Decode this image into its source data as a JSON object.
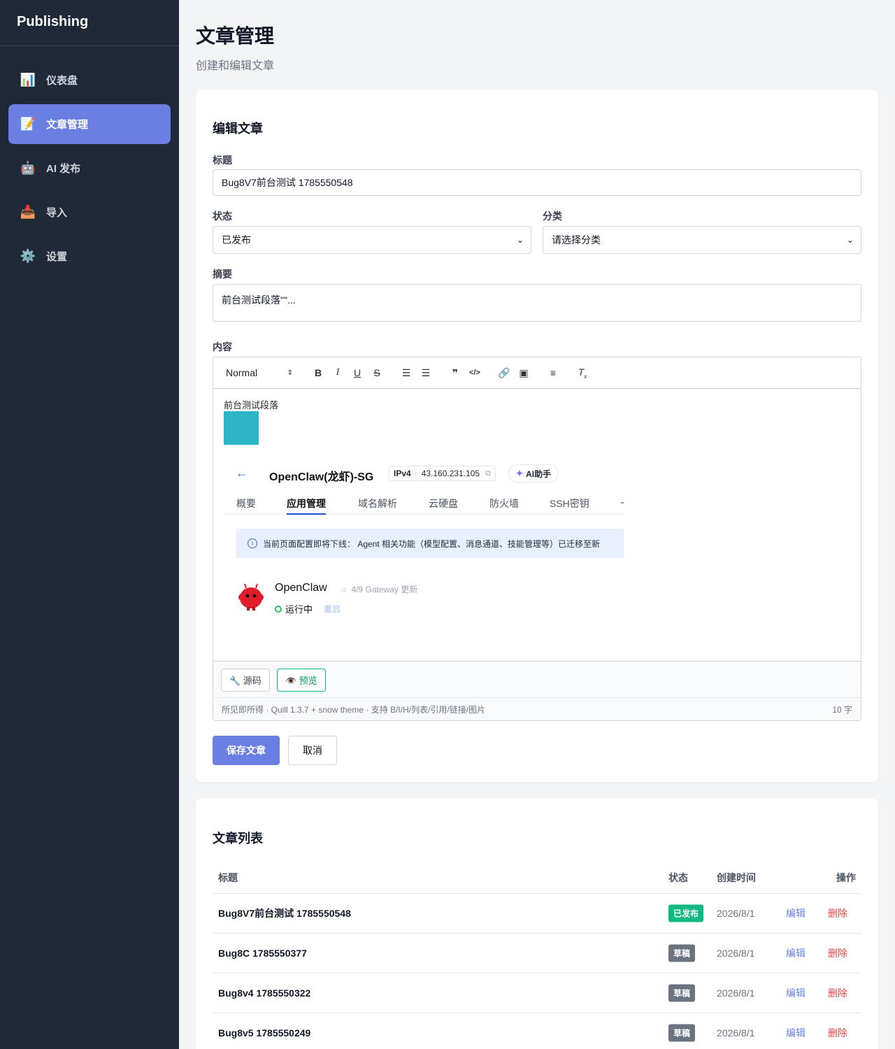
{
  "sidebar": {
    "brand": "Publishing",
    "items": [
      {
        "icon": "📊",
        "label": "仪表盘"
      },
      {
        "icon": "📝",
        "label": "文章管理"
      },
      {
        "icon": "🤖",
        "label": "AI 发布"
      },
      {
        "icon": "📥",
        "label": "导入"
      },
      {
        "icon": "⚙️",
        "label": "设置"
      }
    ]
  },
  "header": {
    "title": "文章管理",
    "subtitle": "创建和编辑文章"
  },
  "form": {
    "card_title": "编辑文章",
    "title_label": "标题",
    "title_value": "Bug8V7前台测试 1785550548",
    "status_label": "状态",
    "status_value": "已发布",
    "category_label": "分类",
    "category_value": "请选择分类",
    "summary_label": "摘要",
    "summary_value": "前台测试段落\"\"...",
    "content_label": "内容",
    "toolbar_header": "Normal",
    "content_text": "前台测试段落",
    "source_btn": "🔧 源码",
    "preview_btn": "👁️ 预览",
    "status_bar_left": "所见即所得 · Quill 1.3.7 + snow theme · 支持 B/I/H/列表/引用/链接/图片",
    "status_bar_right": "10 字",
    "save_btn": "保存文章",
    "cancel_btn": "取消"
  },
  "embedded": {
    "back": "←",
    "title": "OpenClaw(龙虾)-SG",
    "ip_tag": "IPv4",
    "ip": "43.160.231.105",
    "ai_btn": "AI助手",
    "tabs": [
      "概要",
      "应用管理",
      "域名解析",
      "云硬盘",
      "防火墙",
      "SSH密钥",
      "十"
    ],
    "notice": "当前页面配置即将下线： Agent 相关功能（模型配置、消息通道、技能管理等）已迁移至新",
    "app_name": "OpenClaw",
    "update_text": "4/9 Gateway 更新",
    "status": "运行中",
    "restart": "重启"
  },
  "list": {
    "title": "文章列表",
    "headers": {
      "title": "标题",
      "status": "状态",
      "created": "创建时间",
      "actions": "操作"
    },
    "edit_label": "编辑",
    "delete_label": "删除",
    "rows": [
      {
        "title": "Bug8V7前台测试 1785550548",
        "status": "已发布",
        "date": "2026/8/1"
      },
      {
        "title": "Bug8C 1785550377",
        "status": "草稿",
        "date": "2026/8/1"
      },
      {
        "title": "Bug8v4 1785550322",
        "status": "草稿",
        "date": "2026/8/1"
      },
      {
        "title": "Bug8v5 1785550249",
        "status": "草稿",
        "date": "2026/8/1"
      }
    ]
  },
  "colors": {
    "accent": "#6b7fe3",
    "sidebar_bg": "#1f2937",
    "published": "#10b981",
    "draft": "#6b7280",
    "danger": "#ef4444"
  }
}
